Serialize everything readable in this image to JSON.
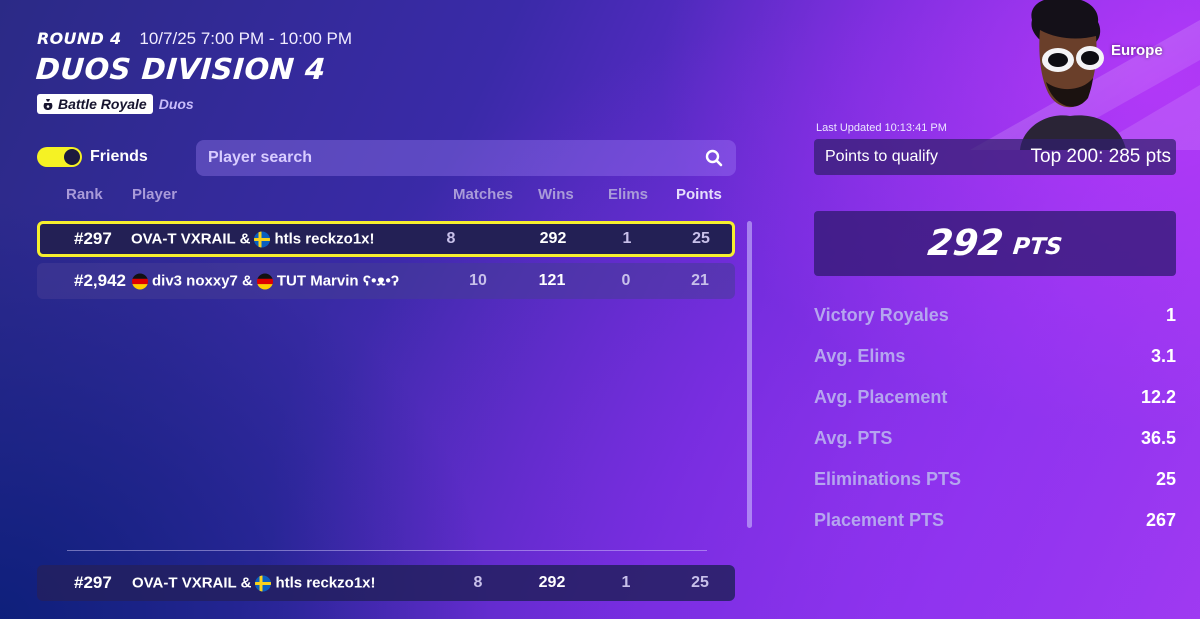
{
  "header": {
    "round": "ROUND 4",
    "date_range": "10/7/25 7:00 PM - 10:00 PM",
    "title": "DUOS DIVISION 4",
    "mode_badge": "Battle Royale",
    "mode_sub": "Duos"
  },
  "controls": {
    "friends_label": "Friends",
    "friends_toggle_on": true,
    "search_placeholder": "Player search"
  },
  "table": {
    "columns": [
      "Rank",
      "Player",
      "Matches",
      "Wins",
      "Elims",
      "Points"
    ],
    "rows": [
      {
        "rank": "#297",
        "player_a": "OVA-T VXRAIL &",
        "flag": "sweden",
        "player_b": "htls reckzo1x!",
        "matches": "8",
        "wins": "292",
        "elims": "1",
        "points": "25",
        "highlighted": true
      },
      {
        "rank": "#2,942",
        "flag_a": "germany",
        "player_a": "div3 noxxy7 &",
        "flag": "germany",
        "player_b": "TUT Marvin ʕ•ᴥ•ʔ",
        "matches": "10",
        "wins": "121",
        "elims": "0",
        "points": "21"
      }
    ],
    "pinned_row": {
      "rank": "#297",
      "player_a": "OVA-T VXRAIL &",
      "flag": "sweden",
      "player_b": "htls reckzo1x!",
      "matches": "8",
      "wins": "292",
      "elims": "1",
      "points": "25"
    }
  },
  "panel": {
    "region": "Europe",
    "last_updated": "Last Updated 10:13:41 PM",
    "qualify_label": "Points to qualify",
    "qualify_value": "Top 200: 285 pts",
    "total_points": "292",
    "total_unit": "PTS",
    "stats": [
      {
        "label": "Victory Royales",
        "value": "1"
      },
      {
        "label": "Avg. Elims",
        "value": "3.1"
      },
      {
        "label": "Avg. Placement",
        "value": "12.2"
      },
      {
        "label": "Avg. PTS",
        "value": "36.5"
      },
      {
        "label": "Eliminations PTS",
        "value": "25"
      },
      {
        "label": "Placement PTS",
        "value": "267"
      }
    ]
  },
  "colors": {
    "highlight_border": "#f6ef2e",
    "toggle_on": "#f5f224",
    "stat_label": "#b5a5ef"
  }
}
